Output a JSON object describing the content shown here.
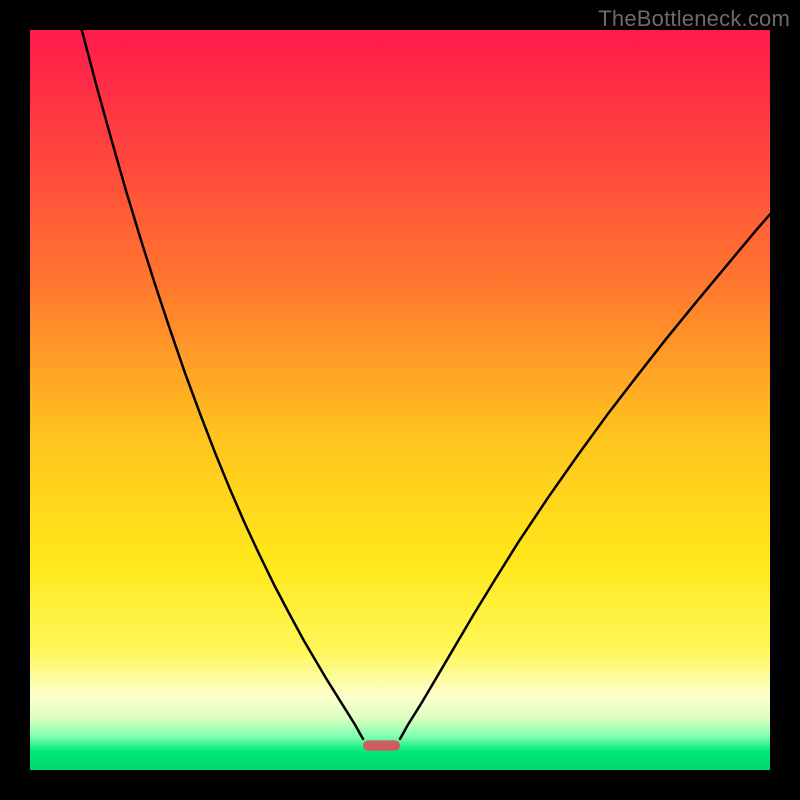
{
  "watermark": "TheBottleneck.com",
  "chart_data": {
    "type": "line",
    "title": "",
    "xlabel": "",
    "ylabel": "",
    "xlim": [
      0,
      100
    ],
    "ylim": [
      0,
      100
    ],
    "grid": false,
    "legend": false,
    "gradient_stops": [
      {
        "offset": 0.0,
        "color": "#ff1b4b"
      },
      {
        "offset": 0.15,
        "color": "#ff4040"
      },
      {
        "offset": 0.35,
        "color": "#ff7a2e"
      },
      {
        "offset": 0.55,
        "color": "#ffc41e"
      },
      {
        "offset": 0.72,
        "color": "#ffe81a"
      },
      {
        "offset": 0.84,
        "color": "#fff85a"
      },
      {
        "offset": 0.9,
        "color": "#fcffce"
      },
      {
        "offset": 0.93,
        "color": "#dcffc0"
      },
      {
        "offset": 0.955,
        "color": "#7dffb0"
      },
      {
        "offset": 0.975,
        "color": "#00e878"
      },
      {
        "offset": 1.0,
        "color": "#00d96c"
      }
    ],
    "series": [
      {
        "name": "left_curve",
        "stroke": "#000000",
        "points": [
          {
            "x": 7.0,
            "y": 100.0
          },
          {
            "x": 9.0,
            "y": 92.4
          },
          {
            "x": 11.0,
            "y": 85.2
          },
          {
            "x": 13.0,
            "y": 78.2
          },
          {
            "x": 15.0,
            "y": 71.6
          },
          {
            "x": 17.0,
            "y": 65.3
          },
          {
            "x": 19.0,
            "y": 59.3
          },
          {
            "x": 21.0,
            "y": 53.5
          },
          {
            "x": 23.0,
            "y": 48.1
          },
          {
            "x": 25.0,
            "y": 42.9
          },
          {
            "x": 27.0,
            "y": 38.0
          },
          {
            "x": 29.0,
            "y": 33.4
          },
          {
            "x": 31.0,
            "y": 29.1
          },
          {
            "x": 33.0,
            "y": 25.0
          },
          {
            "x": 35.0,
            "y": 21.2
          },
          {
            "x": 37.0,
            "y": 17.5
          },
          {
            "x": 39.0,
            "y": 14.1
          },
          {
            "x": 40.0,
            "y": 12.4
          },
          {
            "x": 41.0,
            "y": 10.8
          },
          {
            "x": 42.0,
            "y": 9.2
          },
          {
            "x": 43.0,
            "y": 7.6
          },
          {
            "x": 44.0,
            "y": 6.0
          },
          {
            "x": 44.6,
            "y": 4.9
          },
          {
            "x": 45.0,
            "y": 4.2
          }
        ]
      },
      {
        "name": "right_curve",
        "stroke": "#000000",
        "points": [
          {
            "x": 50.0,
            "y": 4.2
          },
          {
            "x": 50.4,
            "y": 4.9
          },
          {
            "x": 51.0,
            "y": 6.0
          },
          {
            "x": 52.0,
            "y": 7.6
          },
          {
            "x": 53.0,
            "y": 9.2
          },
          {
            "x": 54.0,
            "y": 10.9
          },
          {
            "x": 56.0,
            "y": 14.3
          },
          {
            "x": 58.0,
            "y": 17.7
          },
          {
            "x": 60.0,
            "y": 21.1
          },
          {
            "x": 63.0,
            "y": 26.0
          },
          {
            "x": 66.0,
            "y": 30.8
          },
          {
            "x": 70.0,
            "y": 36.8
          },
          {
            "x": 74.0,
            "y": 42.5
          },
          {
            "x": 78.0,
            "y": 48.0
          },
          {
            "x": 82.0,
            "y": 53.2
          },
          {
            "x": 86.0,
            "y": 58.3
          },
          {
            "x": 90.0,
            "y": 63.2
          },
          {
            "x": 94.0,
            "y": 68.0
          },
          {
            "x": 98.0,
            "y": 72.8
          },
          {
            "x": 100.0,
            "y": 75.1
          }
        ]
      }
    ],
    "marker": {
      "x_center": 47.5,
      "x_halfwidth": 2.5,
      "y_center": 3.3,
      "height": 1.4,
      "fill": "#cc5d63"
    }
  }
}
